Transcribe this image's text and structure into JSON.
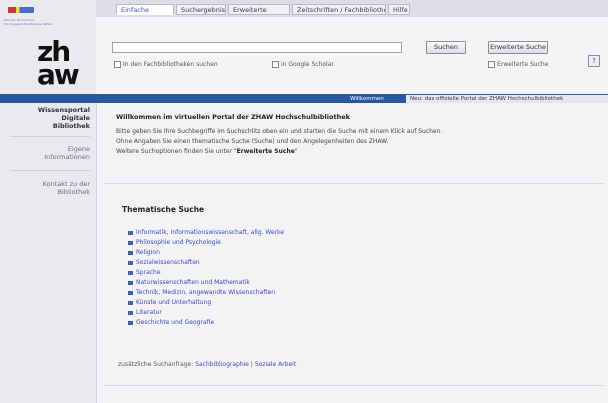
{
  "header": {
    "university_lines": [
      "Zürcher Hochschule",
      "für Angewandte Wissenschaften"
    ],
    "logo_top": "zh",
    "logo_bottom": "aw"
  },
  "tabs": [
    "Einfache Suche",
    "Suchergebnis",
    "Erweiterte Suche",
    "Zeitschriften / Fachbibliothek",
    "Hilfe"
  ],
  "search": {
    "value": "",
    "placeholder": "",
    "submit_label": "Suchen",
    "extended_label": "Erweiterte Suche",
    "option1": "In den Fachbibliotheken suchen",
    "option2": "in Google Scholar",
    "option3": "Erweiterte Suche",
    "help": "?"
  },
  "subtabs": {
    "active": "Willkommen",
    "other": "Neu: das offizielle Portal der ZHAW Hochschulbibliothek"
  },
  "left_nav": {
    "item1_line1": "Wissensportal",
    "item1_line2": "Digitale",
    "item1_line3": "Bibliothek",
    "item2_line1": "Eigene",
    "item2_line2": "Informationen",
    "item3_line1": "Kontakt zu der",
    "item3_line2": "Bibliothek"
  },
  "intro": {
    "title": "Willkommen im virtuellen Portal der ZHAW Hochschulbibliothek",
    "line1": "Bitte geben Sie Ihre Suchbegriffe im Suchschlitz oben ein und starten die Suche mit einem Klick auf Suchen.",
    "line2": "Ohne Angaben Sie einen thematische Suche (Suche) und den Angelegenheiten des ZHAW.",
    "line3_prefix": "Weitere Suchoptionen finden Sie unter \"",
    "line3_bold": "Erweiterte Suche",
    "line3_suffix": "\""
  },
  "thematic": {
    "title": "Thematische Suche",
    "categories": [
      "Informatik, Informationswissenschaft, allg. Werke",
      "Philosophie und Psychologie",
      "Religion",
      "Sozialwissenschaften",
      "Sprache",
      "Naturwissenschaften und Mathematik",
      "Technik, Medizin, angewandte Wissenschaften",
      "Künste und Unterhaltung",
      "Literatur",
      "Geschichte und Geografie"
    ],
    "extra_prefix": "zusätzliche Suchanfrage:",
    "extra_link1": "Sachbibliographie",
    "extra_sep": "|",
    "extra_link2": "Soziale Arbeit"
  },
  "colors": {
    "accent": "#28569f",
    "link": "#3b45c8"
  }
}
